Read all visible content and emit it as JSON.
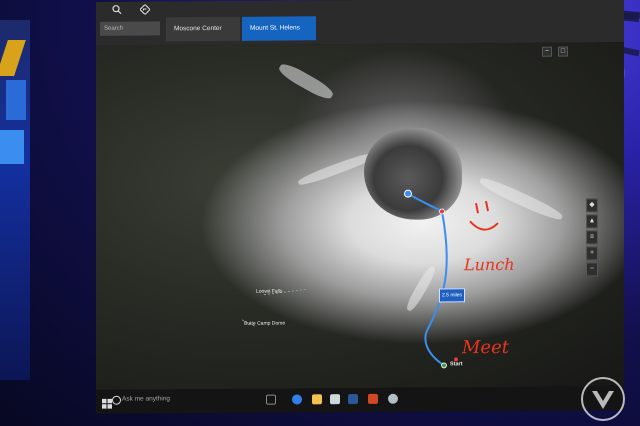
{
  "app": {
    "tabs": [
      {
        "label": "Moscone Center",
        "active": false
      },
      {
        "label": "Mount St. Helens",
        "active": true
      }
    ],
    "search_placeholder": "Search",
    "toolbar_icons": [
      "search-icon",
      "directions-icon"
    ]
  },
  "map": {
    "route": {
      "distance_label": "2.5 miles",
      "start_label": "Start"
    },
    "places": [
      {
        "label": "Loowit Falls"
      },
      {
        "label": "Butte Camp Dome"
      }
    ],
    "annotations": {
      "lunch": "Lunch",
      "meet": "Meet"
    },
    "controls": [
      "compass-icon",
      "tilt-icon",
      "layers-icon",
      "zoom-in-icon",
      "zoom-out-icon"
    ]
  },
  "taskbar": {
    "cortana_placeholder": "Ask me anything",
    "pinned_icons": [
      {
        "name": "task-view-icon",
        "color": "#888888"
      },
      {
        "name": "edge-icon",
        "color": "#2f80ed"
      },
      {
        "name": "file-explorer-icon",
        "color": "#f2c14e"
      },
      {
        "name": "store-icon",
        "color": "#cfd8dc"
      },
      {
        "name": "word-icon",
        "color": "#2b5797"
      },
      {
        "name": "powerpoint-icon",
        "color": "#d24726"
      },
      {
        "name": "maps-icon",
        "color": "#b0bec5"
      }
    ]
  },
  "colors": {
    "accent": "#1565c0",
    "route": "#3b8ef0",
    "ink": "#e8341f"
  }
}
